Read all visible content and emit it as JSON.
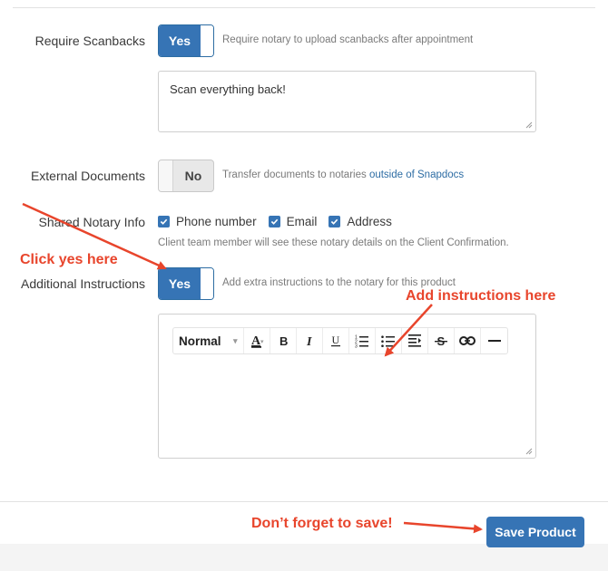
{
  "scanbacks": {
    "label": "Require Scanbacks",
    "toggle": "Yes",
    "hint": "Require notary to upload scanbacks after appointment",
    "text": "Scan everything back!"
  },
  "external_documents": {
    "label": "External Documents",
    "toggle": "No",
    "hint_prefix": "Transfer documents to notaries ",
    "hint_link": "outside of Snapdocs"
  },
  "shared_info": {
    "label": "Shared Notary Info",
    "options": [
      {
        "label": "Phone number",
        "checked": true
      },
      {
        "label": "Email",
        "checked": true
      },
      {
        "label": "Address",
        "checked": true
      }
    ],
    "hint": "Client team member will see these notary details on the Client Confirmation."
  },
  "additional_instructions": {
    "label": "Additional Instructions",
    "toggle": "Yes",
    "hint": "Add extra instructions to the notary for this product",
    "editor": {
      "format_select": "Normal",
      "tools": [
        "font-color-icon",
        "bold-icon",
        "italic-icon",
        "underline-icon",
        "ordered-list-icon",
        "bullet-list-icon",
        "indent-icon",
        "strikethrough-icon",
        "link-icon",
        "horizontal-rule-icon"
      ],
      "text": ""
    }
  },
  "annotations": {
    "click_yes": "Click yes here",
    "add_instructions": "Add instructions here",
    "dont_forget": "Don’t forget to save!"
  },
  "footer": {
    "save_label": "Save Product"
  },
  "colors": {
    "primary": "#3674b5",
    "annotation": "#e8452c",
    "link": "#2e6da4"
  }
}
